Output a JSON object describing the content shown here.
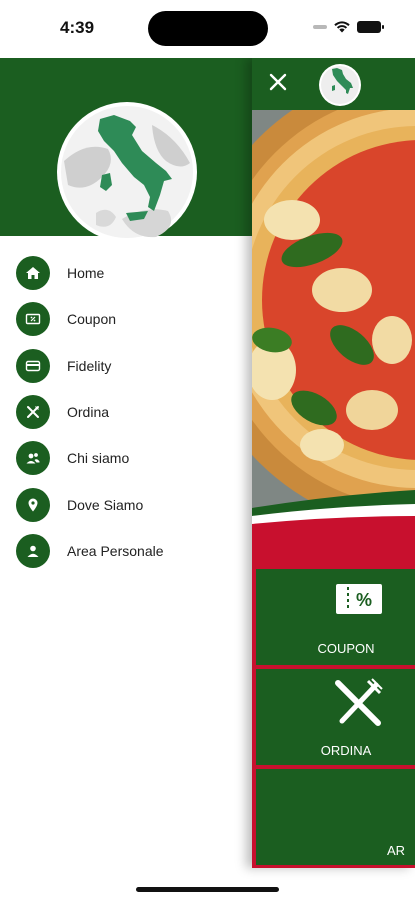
{
  "status_bar": {
    "time": "4:39"
  },
  "drawer": {
    "menu_items": [
      {
        "label": "Home",
        "icon": "home-icon"
      },
      {
        "label": "Coupon",
        "icon": "coupon-icon"
      },
      {
        "label": "Fidelity",
        "icon": "card-icon"
      },
      {
        "label": "Ordina",
        "icon": "cutlery-icon"
      },
      {
        "label": "Chi siamo",
        "icon": "people-icon"
      },
      {
        "label": "Dove Siamo",
        "icon": "location-pin-icon"
      },
      {
        "label": "Area Personale",
        "icon": "person-icon"
      }
    ]
  },
  "main": {
    "tiles": [
      {
        "label": "COUPON",
        "icon": "coupon-icon"
      },
      {
        "label": "ORDINA",
        "icon": "cutlery-icon"
      },
      {
        "label": "AR",
        "icon": ""
      }
    ]
  },
  "colors": {
    "primary_green": "#1b5e20",
    "accent_red": "#c8102e",
    "background": "#ffffff"
  }
}
